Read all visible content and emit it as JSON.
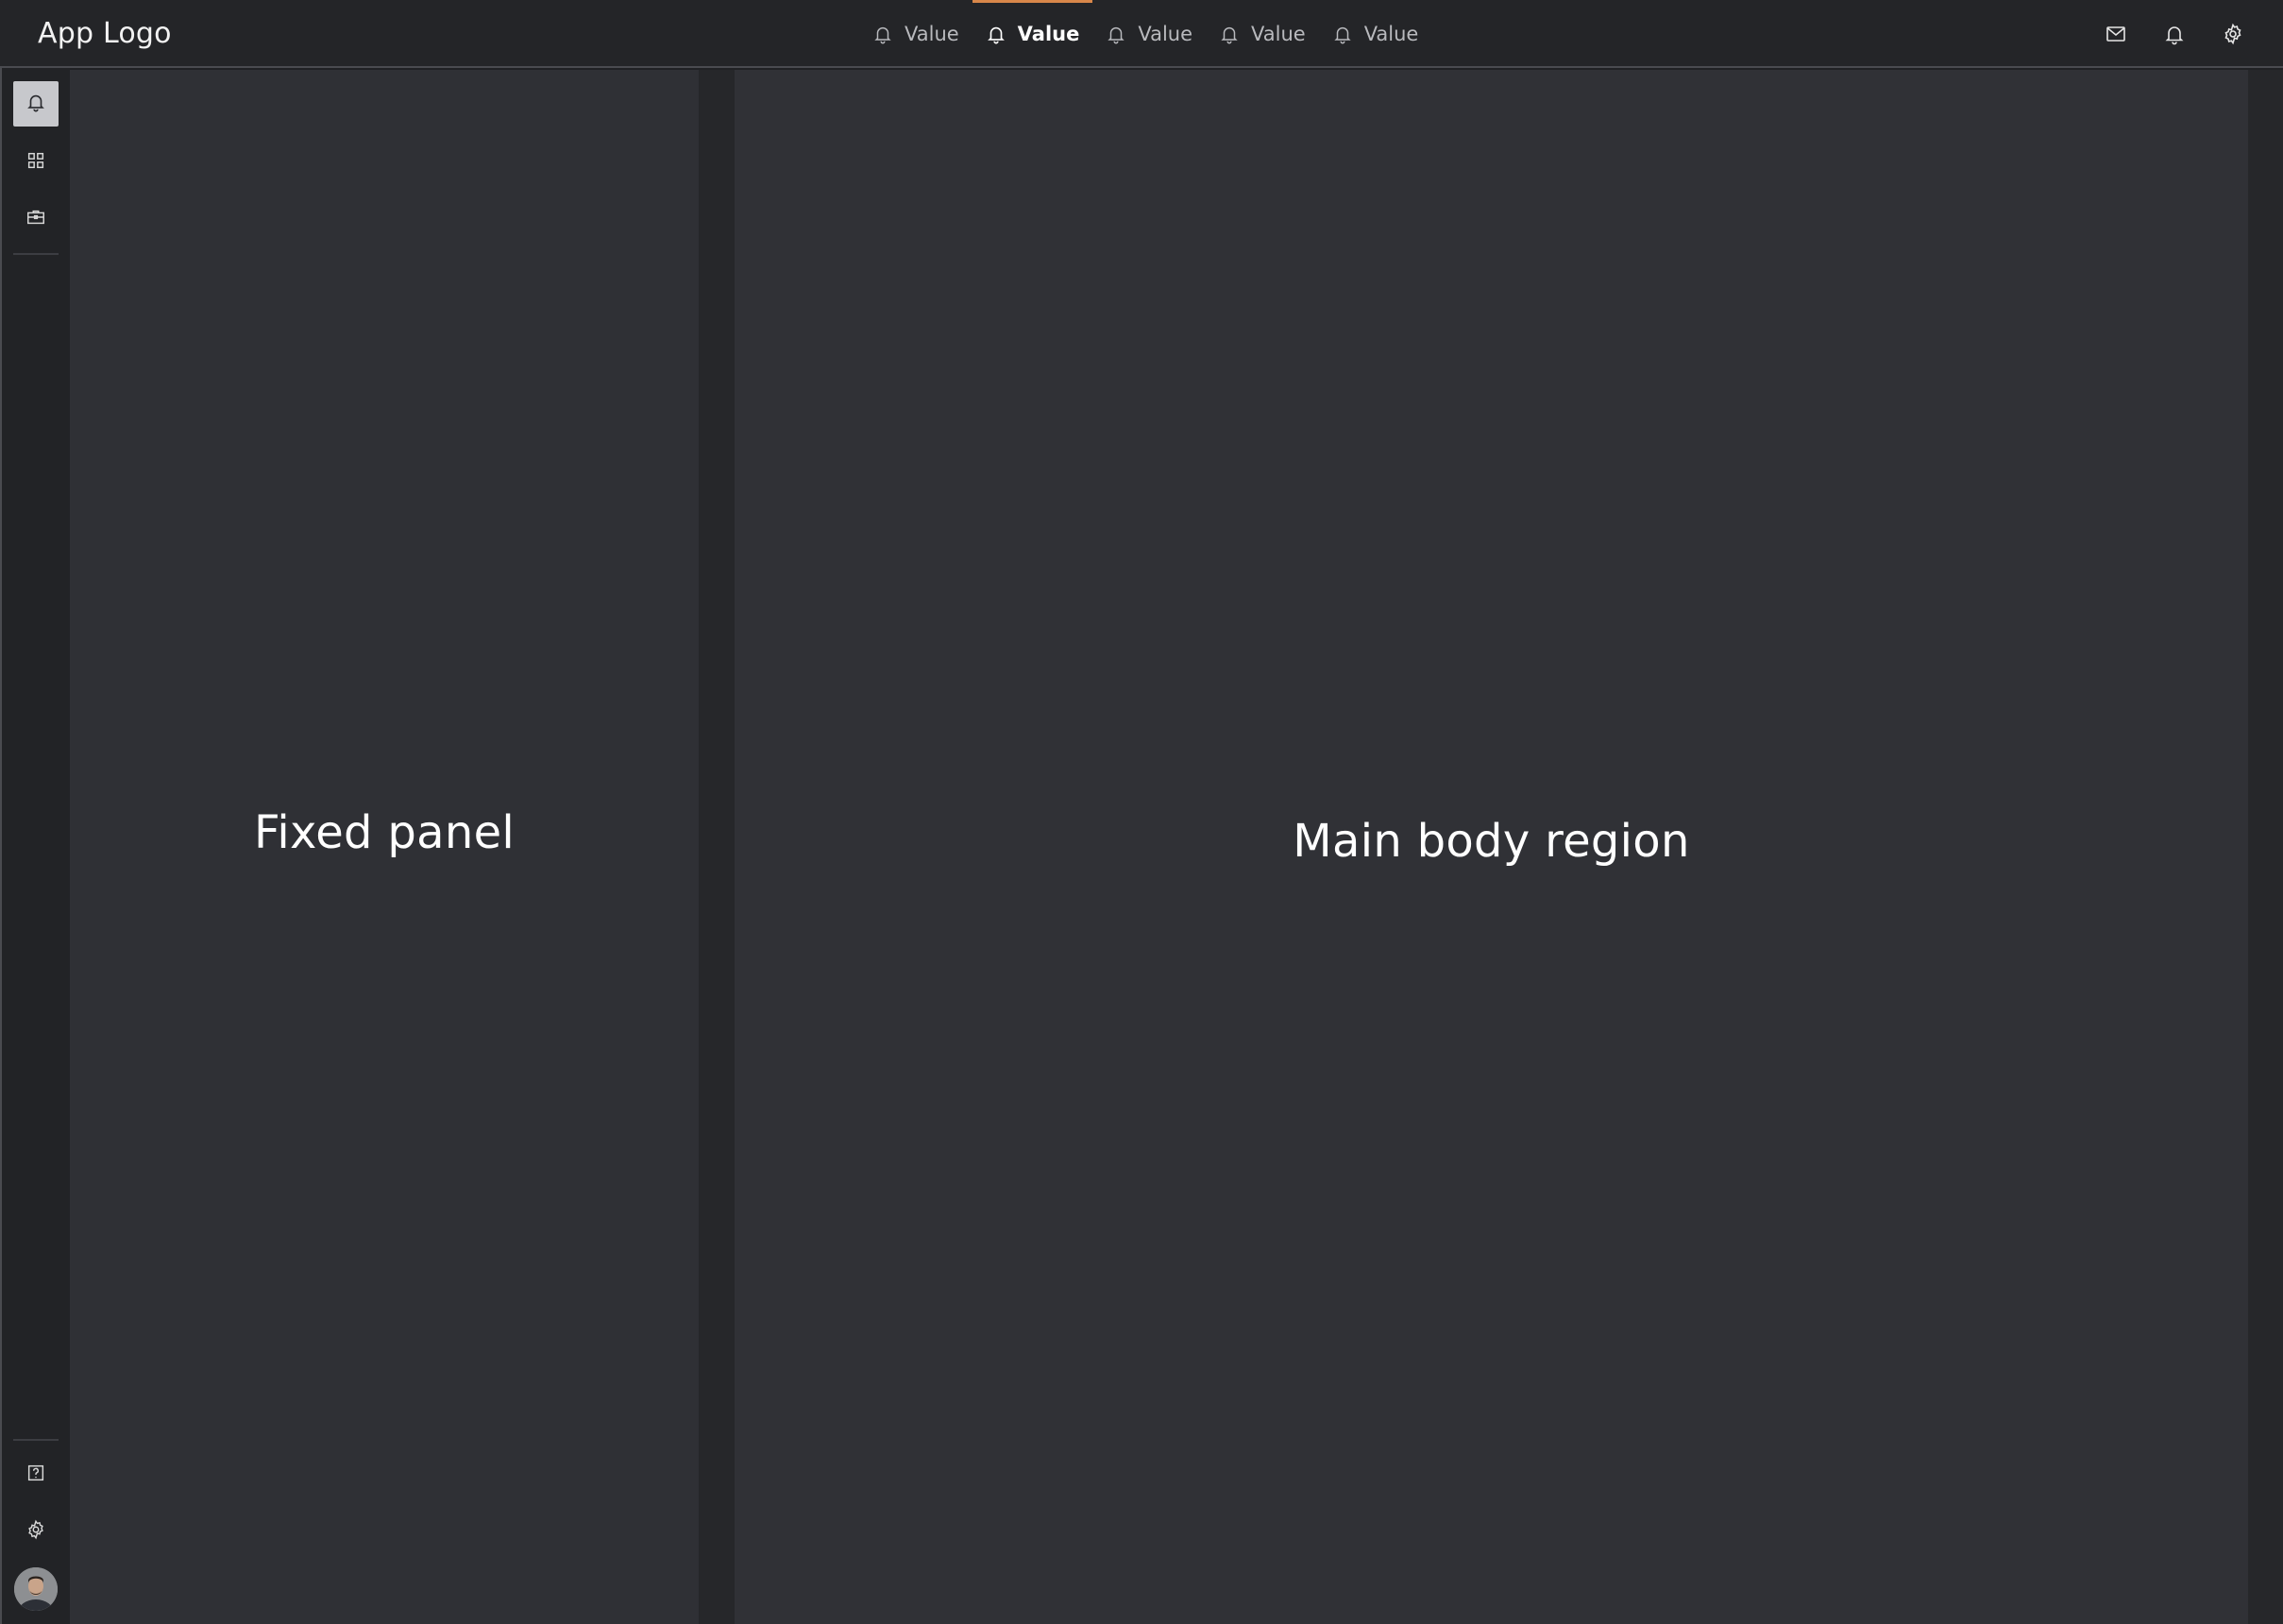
{
  "header": {
    "logo": "App Logo",
    "tabs": [
      {
        "label": "Value",
        "icon": "bell-icon",
        "active": false
      },
      {
        "label": "Value",
        "icon": "bell-icon",
        "active": true
      },
      {
        "label": "Value",
        "icon": "bell-icon",
        "active": false
      },
      {
        "label": "Value",
        "icon": "bell-icon",
        "active": false
      },
      {
        "label": "Value",
        "icon": "bell-icon",
        "active": false
      }
    ],
    "actions": [
      "mail-icon",
      "bell-icon",
      "gear-icon"
    ]
  },
  "rail": {
    "top_items": [
      "bell-icon",
      "grid-icon",
      "briefcase-icon"
    ],
    "bottom_items": [
      "help-icon",
      "gear-icon",
      "avatar"
    ]
  },
  "panels": {
    "fixed_panel_label": "Fixed panel",
    "main_body_label": "Main body region"
  },
  "colors": {
    "accent": "#d8874a",
    "header_bg": "#242528",
    "panel_bg": "#2f3035"
  }
}
